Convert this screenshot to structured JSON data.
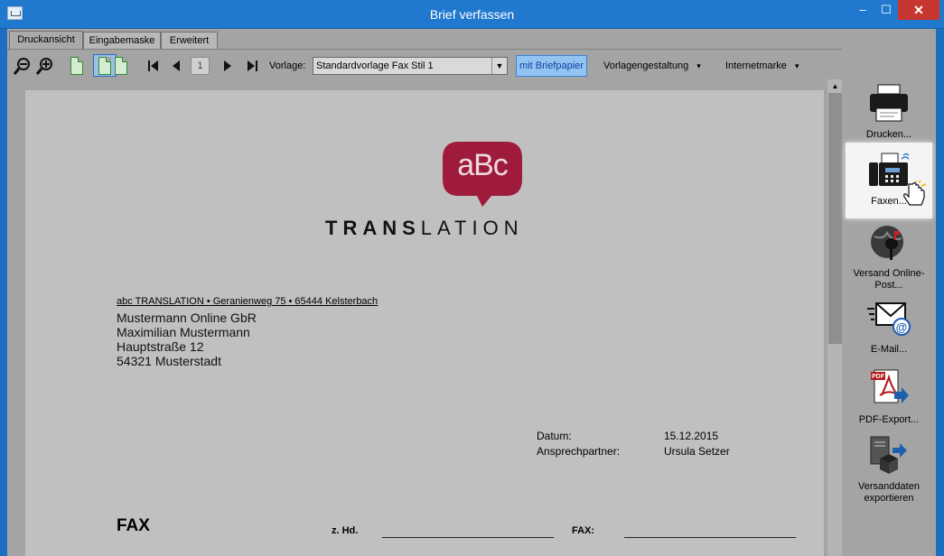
{
  "window": {
    "title": "Brief verfassen",
    "minimize": "–",
    "maximize": "☐",
    "close": "✕"
  },
  "tabs": [
    {
      "label": "Druckansicht",
      "active": true
    },
    {
      "label": "Eingabemaske",
      "active": false
    },
    {
      "label": "Erweitert",
      "active": false
    }
  ],
  "toolbar": {
    "page_number": "1",
    "vorlage_label": "Vorlage:",
    "vorlage_value": "Standardvorlage Fax Stil 1",
    "mit_briefpapier": "mit Briefpapier",
    "vorlagengestaltung": "Vorlagengestaltung",
    "internetmarke": "Internetmarke",
    "dropdown_caret": "▾"
  },
  "document": {
    "logo_text": "aBc",
    "logo_word_bold": "TRANS",
    "logo_word_rest": "LATION",
    "sender_line": "abc TRANSLATION • Geranienweg 75 • 65444 Kelsterbach",
    "recipient": [
      "Mustermann Online GbR",
      "Maximilian Mustermann",
      "Hauptstraße 12",
      "54321 Musterstadt"
    ],
    "datum_label": "Datum:",
    "datum_value": "15.12.2015",
    "ansprech_label": "Ansprechpartner:",
    "ansprech_value": "Ursula Setzer",
    "fax_title": "FAX",
    "zhd_label": "z. Hd.",
    "fax_label": "FAX:"
  },
  "actions": [
    {
      "label": "Drucken...",
      "icon": "printer-icon"
    },
    {
      "label": "Faxen...",
      "icon": "fax-icon",
      "highlighted": true
    },
    {
      "label": "Versand Online-Post...",
      "icon": "mailbox-globe-icon"
    },
    {
      "label": "E-Mail...",
      "icon": "email-icon"
    },
    {
      "label": "PDF-Export...",
      "icon": "pdf-icon"
    },
    {
      "label": "Versanddaten exportieren",
      "icon": "export-box-icon"
    }
  ],
  "colors": {
    "accent": "#2079cf",
    "logo": "#9e1b3b",
    "highlight_button": "#93c3f0"
  }
}
